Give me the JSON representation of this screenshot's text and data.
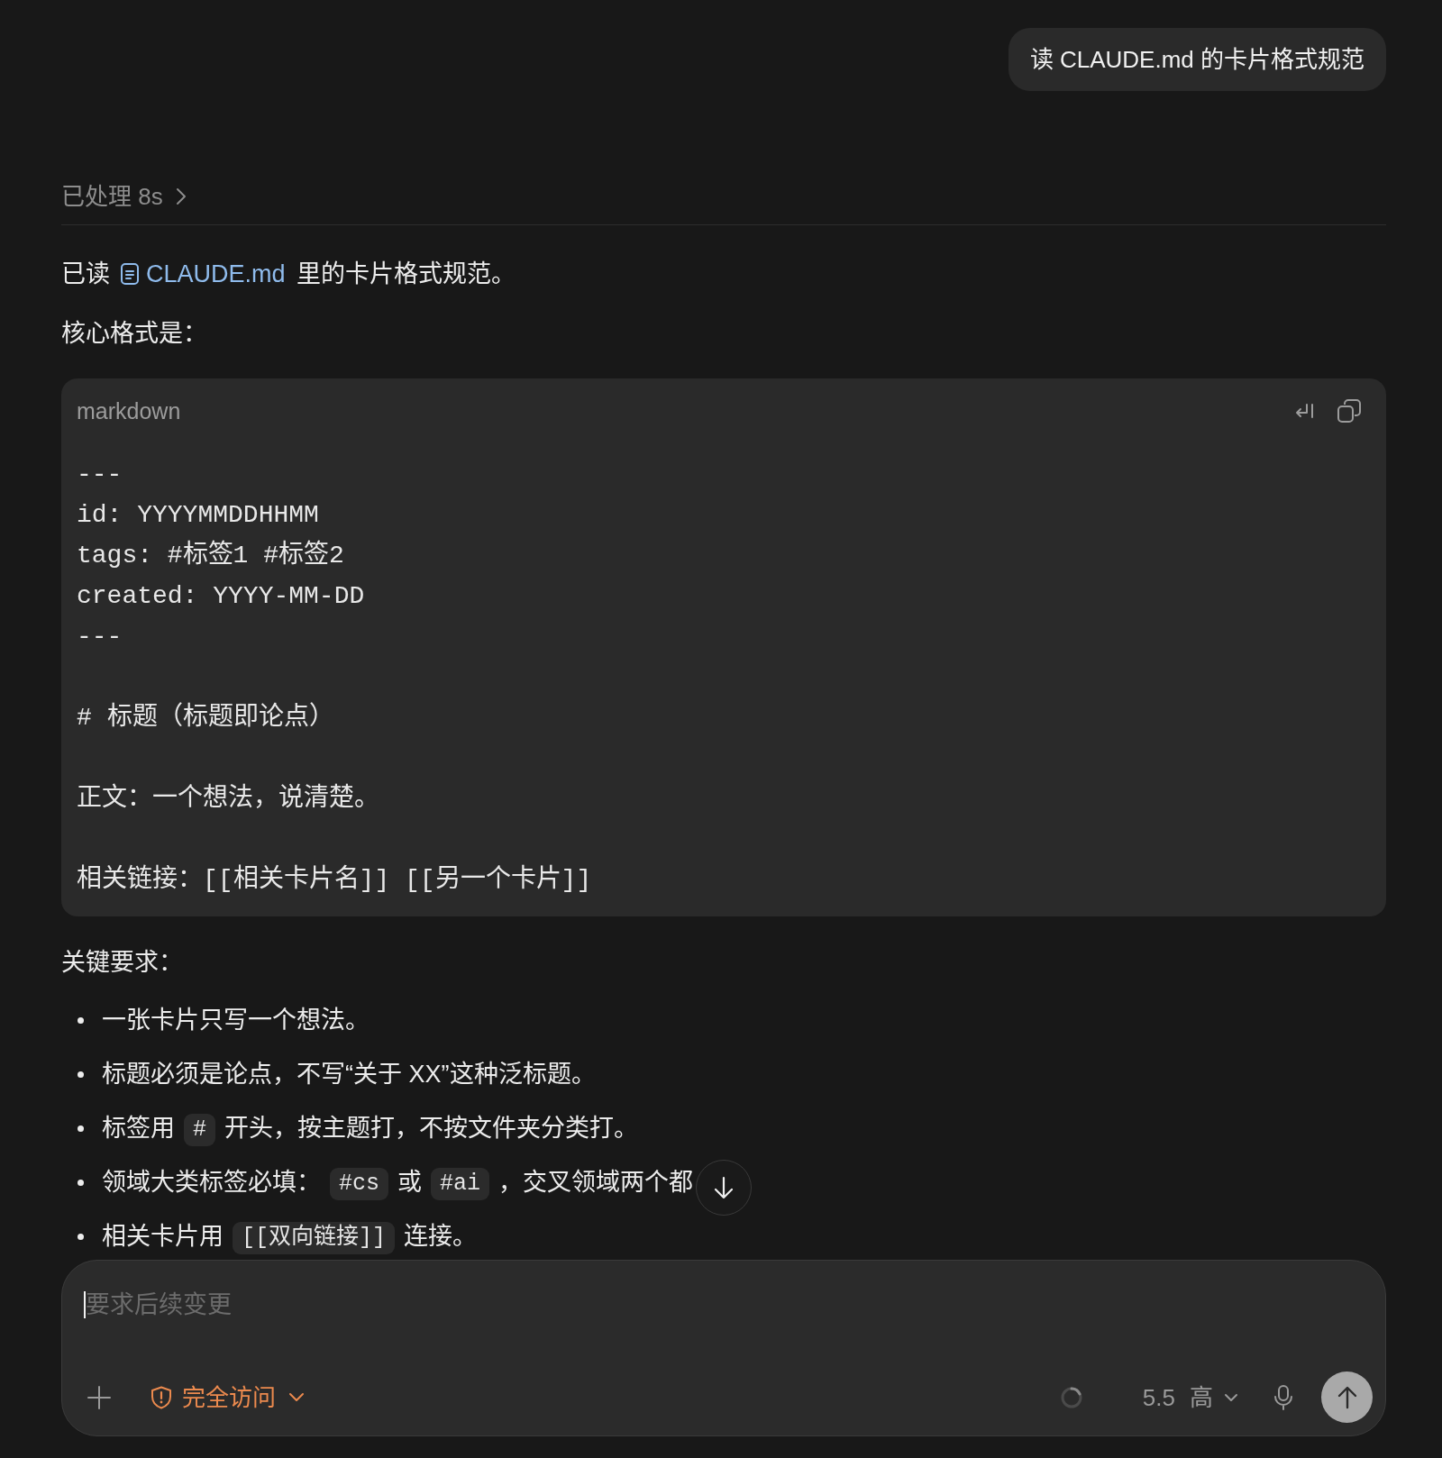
{
  "user_message": {
    "text": "读 CLAUDE.md 的卡片格式规范"
  },
  "processing": {
    "label": "已处理 8s",
    "expanded": false
  },
  "intro": {
    "parts": [
      {
        "kind": "text",
        "text": "已读"
      },
      {
        "kind": "file_link",
        "text": "CLAUDE.md"
      },
      {
        "kind": "text",
        "text": "里的卡片格式规范。"
      }
    ]
  },
  "format_heading": "核心格式是：",
  "code_block": {
    "language": "markdown",
    "sections": [
      [
        "---",
        "id: YYYYMMDDHHMM",
        "tags: #标签1 #标签2",
        "created: YYYY-MM-DD",
        "---"
      ],
      [
        "# 标题（标题即论点）"
      ],
      [
        "正文：一个想法，说清楚。"
      ],
      [
        "相关链接：[[相关卡片名]] [[另一个卡片]]"
      ]
    ]
  },
  "requirements_heading": "关键要求：",
  "requirements": [
    {
      "parts": [
        {
          "kind": "text",
          "text": "一张卡片只写一个想法。"
        }
      ]
    },
    {
      "parts": [
        {
          "kind": "text",
          "text": "标题必须是论点，不写“关于 XX”这种泛标题。"
        }
      ]
    },
    {
      "parts": [
        {
          "kind": "text",
          "text": "标签用"
        },
        {
          "kind": "code",
          "text": "#"
        },
        {
          "kind": "text",
          "text": "开头，按主题打，不按文件夹分类打。"
        }
      ]
    },
    {
      "parts": [
        {
          "kind": "text",
          "text": "领域大类标签必填："
        },
        {
          "kind": "code",
          "text": "#cs"
        },
        {
          "kind": "text",
          "text": "或"
        },
        {
          "kind": "code",
          "text": "#ai"
        },
        {
          "kind": "text",
          "text": "，交叉领域两个都"
        }
      ]
    },
    {
      "parts": [
        {
          "kind": "text",
          "text": "相关卡片用"
        },
        {
          "kind": "code",
          "text": "[[双向链接]]"
        },
        {
          "kind": "text",
          "text": "连接。"
        }
      ]
    }
  ],
  "composer": {
    "placeholder": "要求后续变更",
    "access_label": "完全访问",
    "model_label": "5.5",
    "effort_label": "高"
  }
}
